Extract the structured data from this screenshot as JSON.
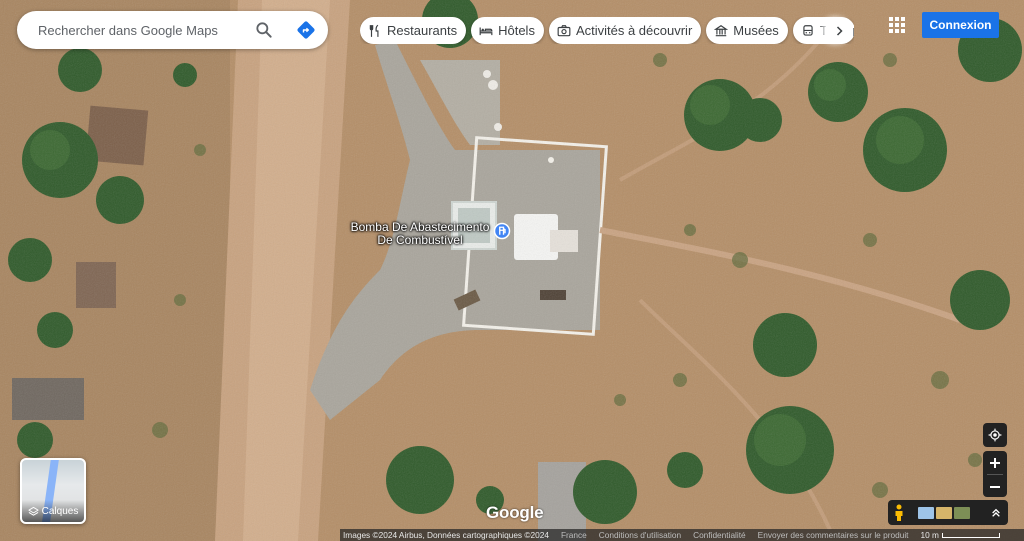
{
  "search": {
    "placeholder": "Rechercher dans Google Maps"
  },
  "chips": [
    {
      "label": "Restaurants",
      "icon": "fork-knife-icon"
    },
    {
      "label": "Hôtels",
      "icon": "bed-icon"
    },
    {
      "label": "Activités à découvrir",
      "icon": "camera-icon"
    },
    {
      "label": "Musées",
      "icon": "museum-icon"
    },
    {
      "label": "Transports",
      "icon": "bus-icon"
    }
  ],
  "header": {
    "signin_label": "Connexion"
  },
  "place": {
    "label": "Bomba De Abastecimento De Combustível"
  },
  "layers": {
    "label": "Calques"
  },
  "logo": {
    "text": "Google"
  },
  "footer": {
    "imagery": "Images ©2024 Airbus, Données cartographiques ©2024",
    "country": "France",
    "terms": "Conditions d'utilisation",
    "privacy": "Confidentialité",
    "feedback": "Envoyer des commentaires sur le produit",
    "scale": "10 m"
  },
  "colors": {
    "accent": "#1a73e8",
    "pin": "#4285f4"
  }
}
